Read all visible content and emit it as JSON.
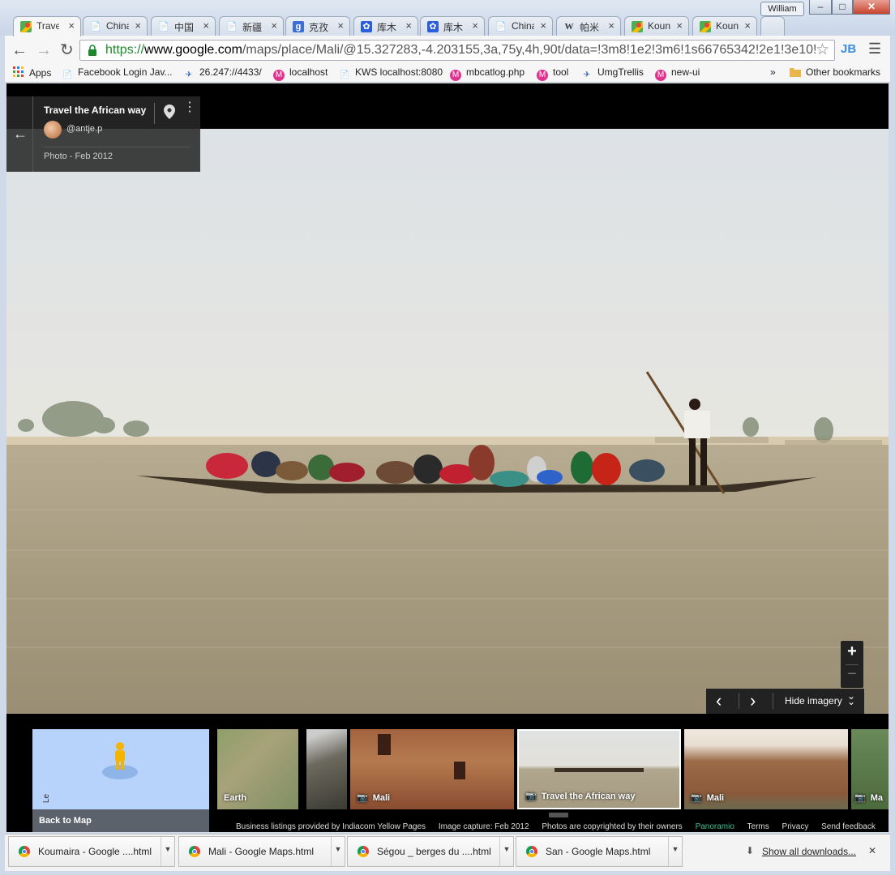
{
  "window": {
    "user": "William",
    "min_label": "–",
    "max_label": "□",
    "close_label": "✕"
  },
  "tabs": [
    {
      "title": "Trave",
      "icon": "google-maps-icon",
      "active": true
    },
    {
      "title": "China",
      "icon": "page-icon"
    },
    {
      "title": "中国",
      "icon": "page-icon"
    },
    {
      "title": "新疆",
      "icon": "page-icon"
    },
    {
      "title": "克孜",
      "icon": "google-search-icon"
    },
    {
      "title": "库木",
      "icon": "baidu-icon"
    },
    {
      "title": "库木",
      "icon": "baidu-icon"
    },
    {
      "title": "China",
      "icon": "page-icon"
    },
    {
      "title": "帕米",
      "icon": "wikipedia-icon"
    },
    {
      "title": "Koun",
      "icon": "google-maps-icon"
    },
    {
      "title": "Koun",
      "icon": "google-maps-icon"
    }
  ],
  "toolbar": {
    "url_scheme": "https://",
    "url_host": "www.google.com",
    "url_path": "/maps/place/Mali/@15.327283,-4.203155,3a,75y,4h,90t/data=!3m8!1e2!3m6!1s66765342!2e1!3e10!",
    "ext_label": "JB"
  },
  "bookmarks": [
    {
      "label": "Apps",
      "icon": "apps-grid-icon"
    },
    {
      "label": "Facebook Login Jav...",
      "icon": "page-icon"
    },
    {
      "label": "26.247://4433/",
      "icon": "satellite-icon"
    },
    {
      "label": "localhost",
      "icon": "m-badge-icon"
    },
    {
      "label": "KWS localhost:8080",
      "icon": "page-icon"
    },
    {
      "label": "mbcatlog.php",
      "icon": "m-badge-icon"
    },
    {
      "label": "tool",
      "icon": "m-badge-icon"
    },
    {
      "label": "UmgTrellis",
      "icon": "satellite-icon"
    },
    {
      "label": "new-ui",
      "icon": "m-badge-icon"
    }
  ],
  "bookmarks_overflow": "»",
  "other_bookmarks": "Other bookmarks",
  "infocard": {
    "title": "Travel the African way",
    "author": "@antje.p",
    "date": "Photo - Feb 2012"
  },
  "controls": {
    "zoom_in": "+",
    "zoom_out": "−",
    "prev": "‹",
    "next": "›",
    "hide_imagery": "Hide imagery"
  },
  "filmstrip": {
    "back_to_map": "Back to Map",
    "map_tile_text": "Le",
    "thumbs": [
      {
        "label": "Earth",
        "camera": false
      },
      {
        "label": "",
        "camera": false
      },
      {
        "label": "Mali",
        "camera": true
      },
      {
        "label": "Travel the African way",
        "camera": true,
        "selected": true
      },
      {
        "label": "Mali",
        "camera": true
      },
      {
        "label": "Ma",
        "camera": true
      }
    ]
  },
  "footer": {
    "business": "Business listings provided by Indiacom Yellow Pages",
    "capture": "Image capture: Feb 2012",
    "copyright": "Photos are copyrighted by their owners",
    "panoramio": "Panoramio",
    "terms": "Terms",
    "privacy": "Privacy",
    "feedback": "Send feedback"
  },
  "downloads": {
    "items": [
      "Koumaira - Google ....html",
      "Mali - Google Maps.html",
      "Ségou _ berges du ....html",
      "San - Google Maps.html"
    ],
    "show_all": "Show all downloads...",
    "close": "✕"
  },
  "colors": {
    "accent_green": "#1c8a2c",
    "maps_blue": "#b7d3fb"
  }
}
